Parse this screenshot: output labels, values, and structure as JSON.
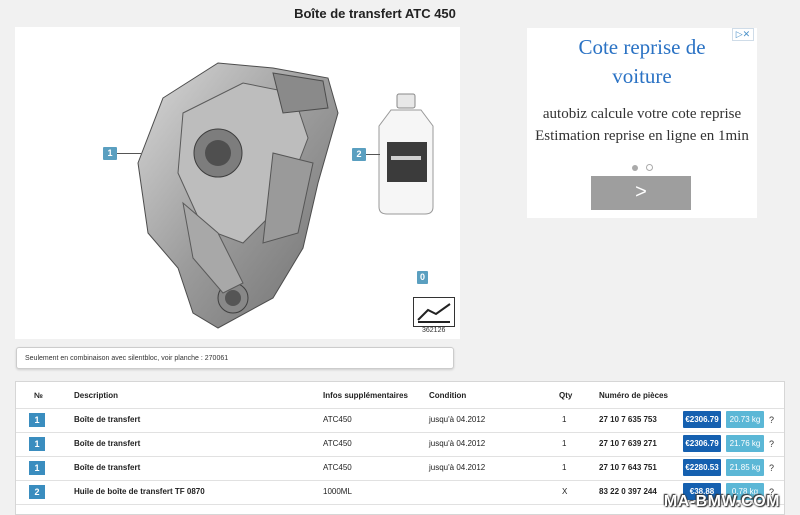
{
  "page": {
    "title": "Boîte de transfert ATC 450"
  },
  "diagram": {
    "callouts": [
      "1",
      "2",
      "0"
    ],
    "ref_number": "362126",
    "icons": [
      "transfer-case-illustration",
      "oil-bottle-illustration"
    ]
  },
  "ad": {
    "close_label": "▷✕",
    "headline": "Cote reprise de voiture",
    "body_lines": [
      "autobiz calcule votre cote reprise",
      "Estimation reprise en ligne en 1min"
    ],
    "button_label": ">"
  },
  "note": {
    "text": "Seulement en combinaison avec silentbloc, voir planche : 270061"
  },
  "table": {
    "headers": [
      "№",
      "Description",
      "Infos supplémentaires",
      "Condition",
      "Qty",
      "Numéro de pièces"
    ],
    "rows": [
      {
        "no": "1",
        "description": "Boîte de transfert",
        "info": "ATC450",
        "condition": "jusqu'à 04.2012",
        "qty": "1",
        "part": "27 10 7 635 753",
        "price": "€2306.79",
        "weight": "20.73 kg",
        "help": "?"
      },
      {
        "no": "1",
        "description": "Boîte de transfert",
        "info": "ATC450",
        "condition": "jusqu'à 04.2012",
        "qty": "1",
        "part": "27 10 7 639 271",
        "price": "€2306.79",
        "weight": "21.76 kg",
        "help": "?"
      },
      {
        "no": "1",
        "description": "Boîte de transfert",
        "info": "ATC450",
        "condition": "jusqu'à 04.2012",
        "qty": "1",
        "part": "27 10 7 643 751",
        "price": "€2280.53",
        "weight": "21.85 kg",
        "help": "?"
      },
      {
        "no": "2",
        "description": "Huile de boîte de transfert TF 0870",
        "info": "1000ML",
        "condition": "",
        "qty": "X",
        "part": "83 22 0 397 244",
        "price": "€38.88",
        "weight": "0.78 kg",
        "help": "?"
      }
    ]
  },
  "watermark": "MA-BMW.COM",
  "colors": {
    "callout": "#5a9fc0",
    "price_button": "#1560b0",
    "weight_button": "#5bb7d6",
    "ad_headline": "#2a72c4"
  }
}
